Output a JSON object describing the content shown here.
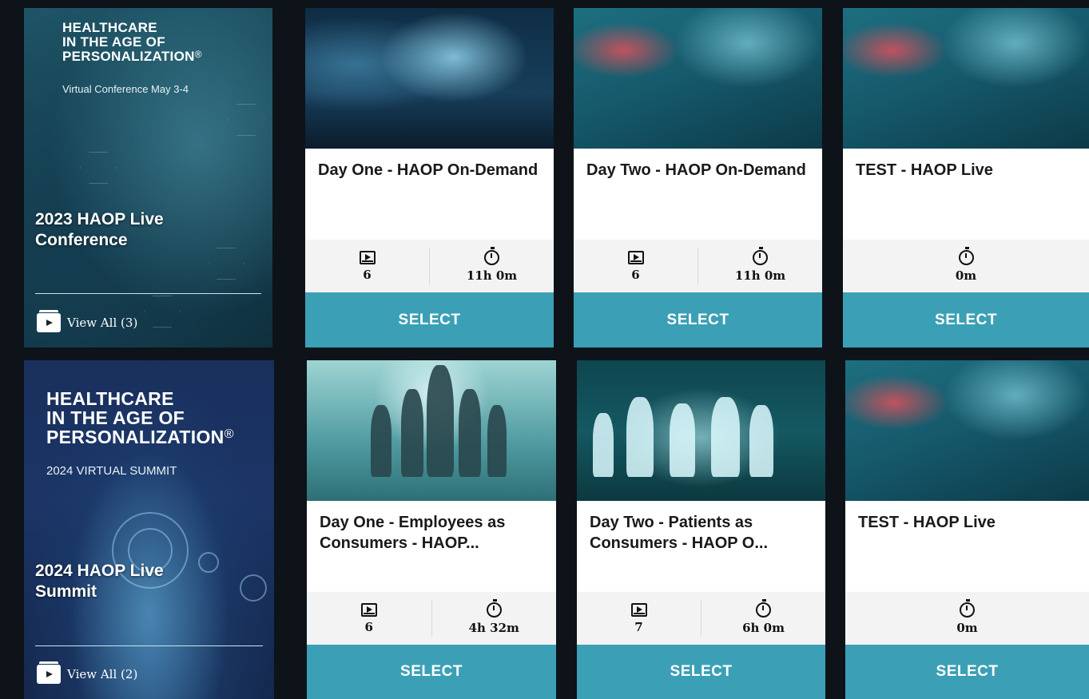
{
  "featured": [
    {
      "brand_lines": [
        "HEALTHCARE",
        "IN THE AGE OF",
        "PERSONALIZATION"
      ],
      "brand_mark": "®",
      "brand_sub": "Virtual Conference May 3-4",
      "title": "2023 HAOP Live Conference",
      "view_all": "View All (3)"
    },
    {
      "brand_lines": [
        "HEALTHCARE",
        "IN THE AGE OF",
        "PERSONALIZATION"
      ],
      "brand_mark": "®",
      "brand_sub": "2024 VIRTUAL SUMMIT",
      "title": "2024 HAOP Live Summit",
      "view_all": "View All (2)"
    }
  ],
  "cards": [
    {
      "title": "Day One - HAOP On-Demand",
      "videos": "6",
      "duration": "11h 0m",
      "button": "SELECT"
    },
    {
      "title": "Day Two - HAOP On-Demand",
      "videos": "6",
      "duration": "11h 0m",
      "button": "SELECT"
    },
    {
      "title": "TEST - HAOP Live",
      "duration": "0m",
      "button": "SELECT"
    },
    {
      "title": "Day One - Employees as Consumers - HAOP...",
      "videos": "6",
      "duration": "4h 32m",
      "button": "SELECT"
    },
    {
      "title": "Day Two - Patients as Consumers - HAOP O...",
      "videos": "7",
      "duration": "6h 0m",
      "button": "SELECT"
    },
    {
      "title": "TEST - HAOP Live",
      "duration": "0m",
      "button": "SELECT"
    }
  ],
  "colors": {
    "background": "#0d1319",
    "accent": "#3ba0b5",
    "stats_bg": "#f3f3f3"
  },
  "icons": {
    "videos": "video-play-icon",
    "duration": "stopwatch-icon",
    "view_all": "video-stack-icon"
  }
}
